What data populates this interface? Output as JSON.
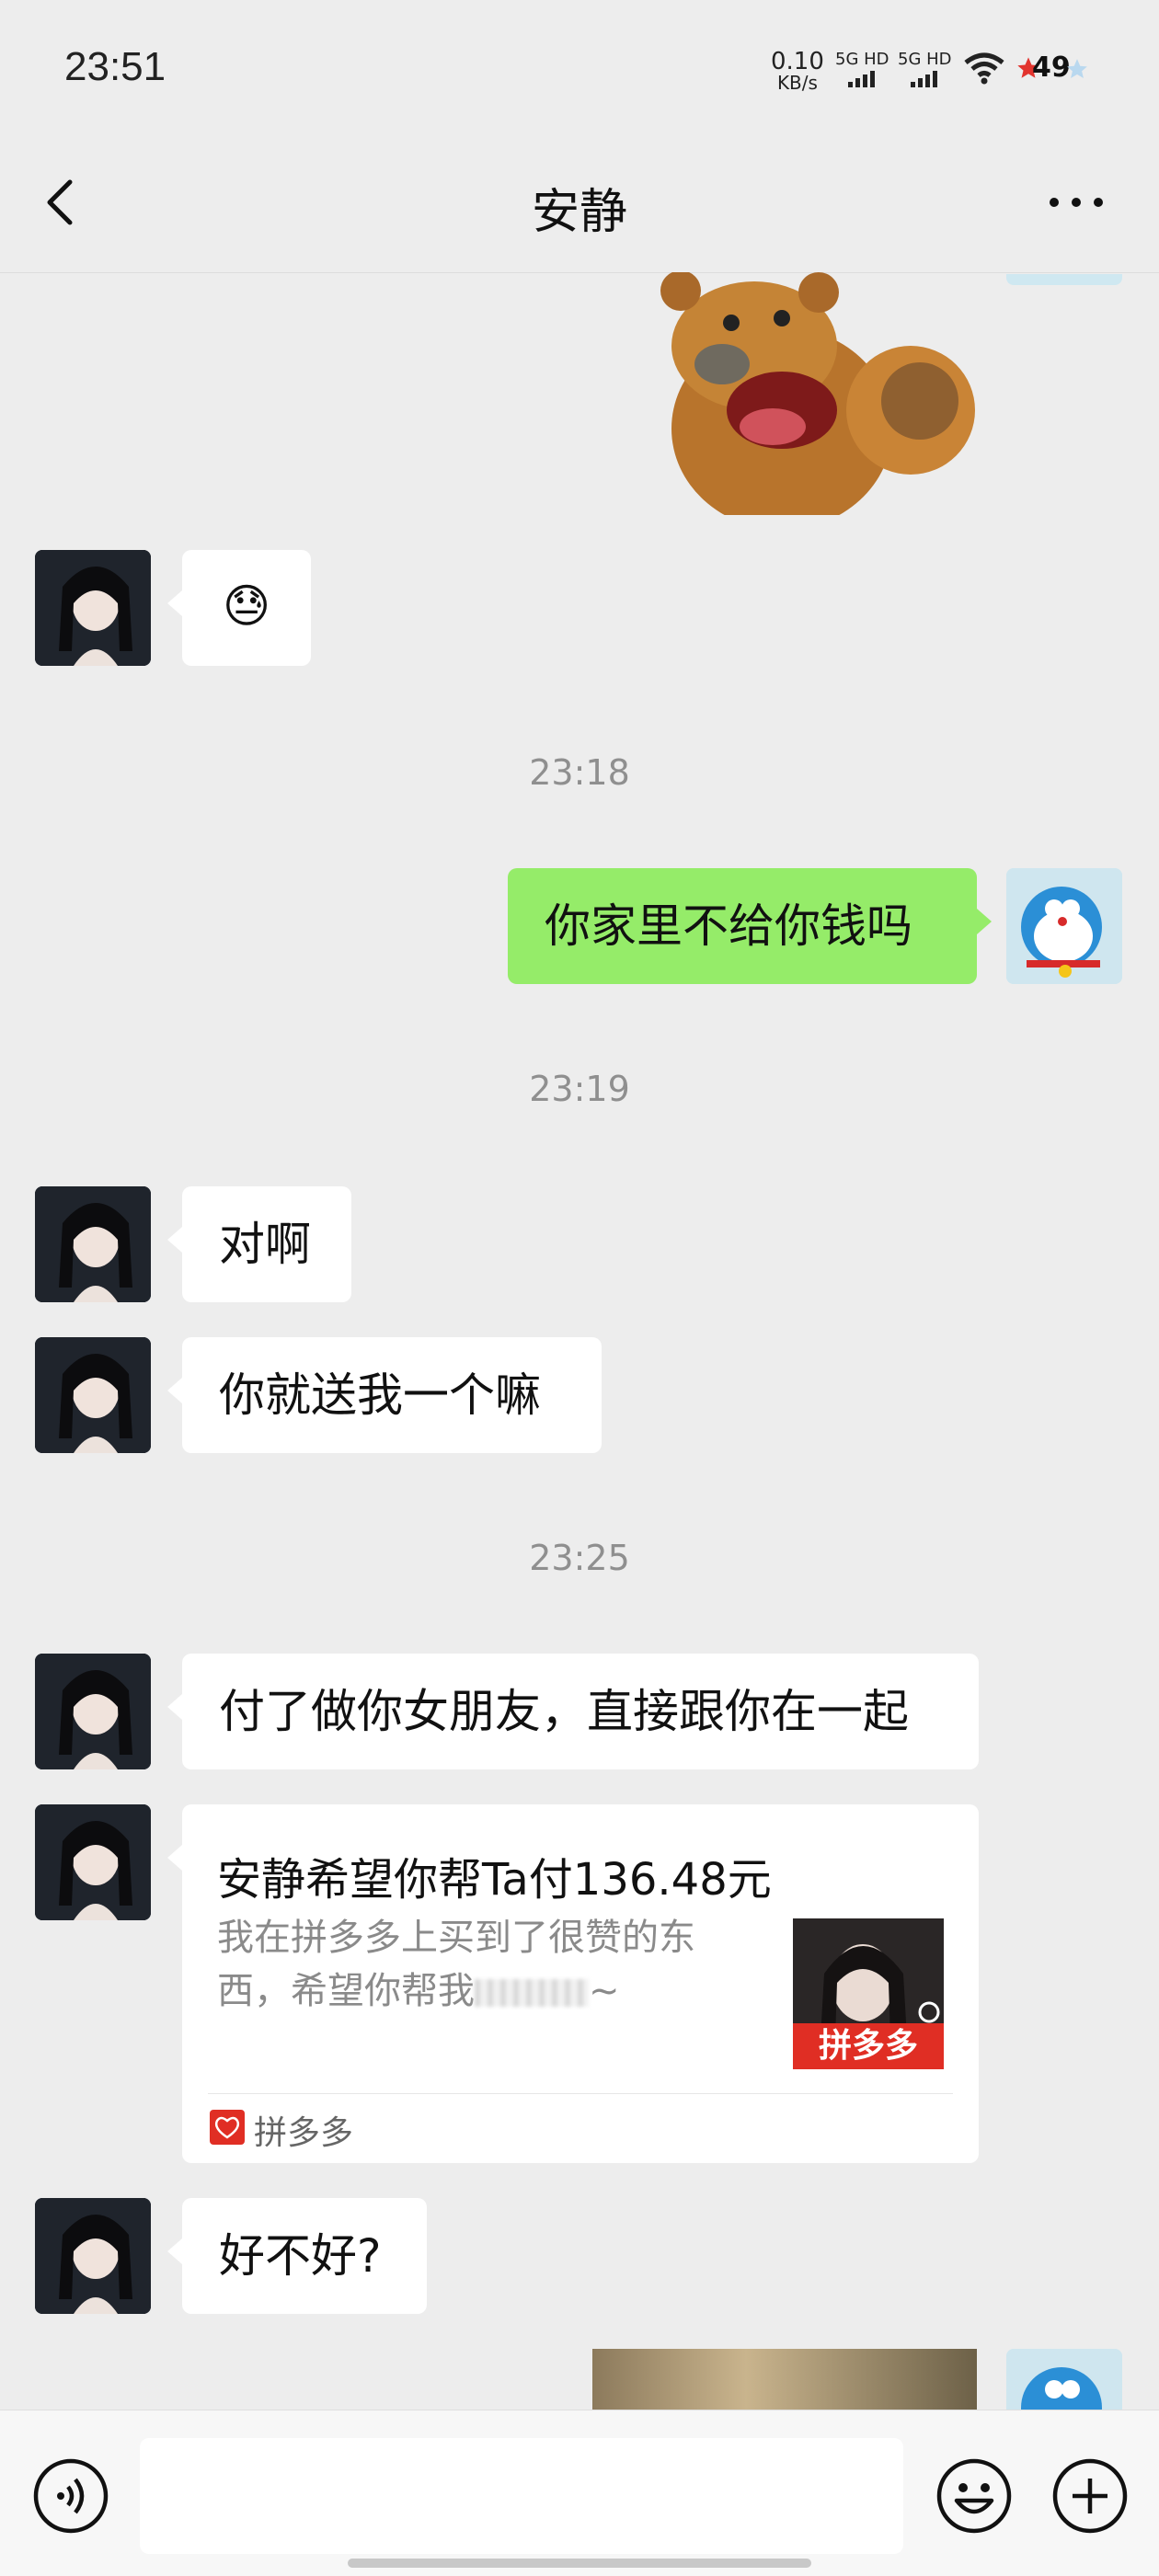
{
  "status": {
    "time": "23:51",
    "speed_value": "0.10",
    "speed_unit": "KB/s",
    "net1": "5G HD",
    "net2": "5G HD",
    "battery": "49"
  },
  "header": {
    "title": "安静"
  },
  "messages": {
    "her_emoji": "😓",
    "ts1": "23:18",
    "me_1": "你家里不给你钱吗",
    "ts2": "23:19",
    "her_1": "对啊",
    "her_2": "你就送我一个嘛",
    "ts3": "23:25",
    "her_3": "付了做你女朋友，直接跟你在一起",
    "her_4": "好不好?"
  },
  "card": {
    "title": "安静希望你帮Ta付136.48元",
    "desc_line1": "我在拼多多上买到了很赞的东",
    "desc_line2": "西，希望你帮我",
    "desc_tail": "~",
    "thumb_label": "拼多多",
    "source": "拼多多"
  },
  "colors": {
    "self_bubble": "#95ec69",
    "other_bubble": "#ffffff",
    "background": "#ededed",
    "pdd_red": "#e02e24"
  },
  "icons": [
    "back-arrow-icon",
    "more-dots-icon",
    "voice-icon",
    "emoji-icon",
    "plus-icon",
    "wifi-icon",
    "signal-icon"
  ]
}
